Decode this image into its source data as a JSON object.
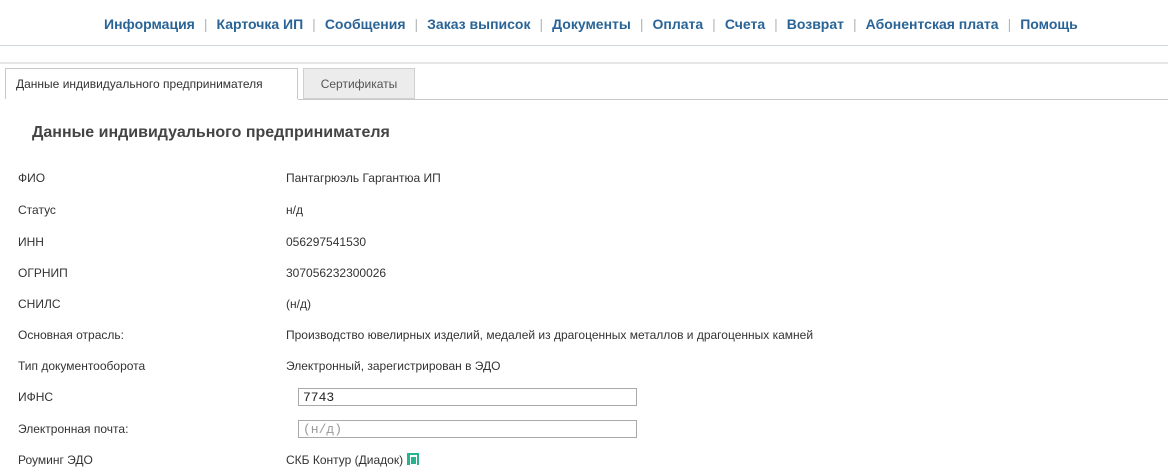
{
  "topnav": {
    "items": [
      "Информация",
      "Карточка ИП",
      "Сообщения",
      "Заказ выписок",
      "Документы",
      "Оплата",
      "Счета",
      "Возврат",
      "Абонентская плата",
      "Помощь"
    ],
    "separator": "|"
  },
  "tabs": {
    "active": "Данные индивидуального предпринимателя",
    "inactive": "Сертификаты"
  },
  "page": {
    "title": "Данные индивидуального предпринимателя"
  },
  "fields": {
    "fio": {
      "label": "ФИО",
      "value": "Пантагрюэль Гаргантюа ИП"
    },
    "status": {
      "label": "Статус",
      "value": "н/д"
    },
    "inn": {
      "label": "ИНН",
      "value": "056297541530"
    },
    "ogrnip": {
      "label": "ОГРНИП",
      "value": "307056232300026"
    },
    "snils": {
      "label": "СНИЛС",
      "value": "(н/д)"
    },
    "industry": {
      "label": "Основная отрасль:",
      "value": "Производство ювелирных изделий, медалей из драгоценных металлов и драгоценных камней"
    },
    "doc_flow": {
      "label": "Тип документооборота",
      "value": "Электронный, зарегистрирован в ЭДО"
    },
    "ifns": {
      "label": "ИФНС",
      "value": "7743"
    },
    "email": {
      "label": "Электронная почта:",
      "value": "",
      "placeholder": "(н/д)"
    },
    "roaming": {
      "label": "Роуминг ЭДО",
      "value": "СКБ Контур (Диадок)",
      "icon": "edo-operator-icon"
    }
  },
  "colors": {
    "nav_link": "#2a6496",
    "edo_icon": "#28b38f"
  }
}
